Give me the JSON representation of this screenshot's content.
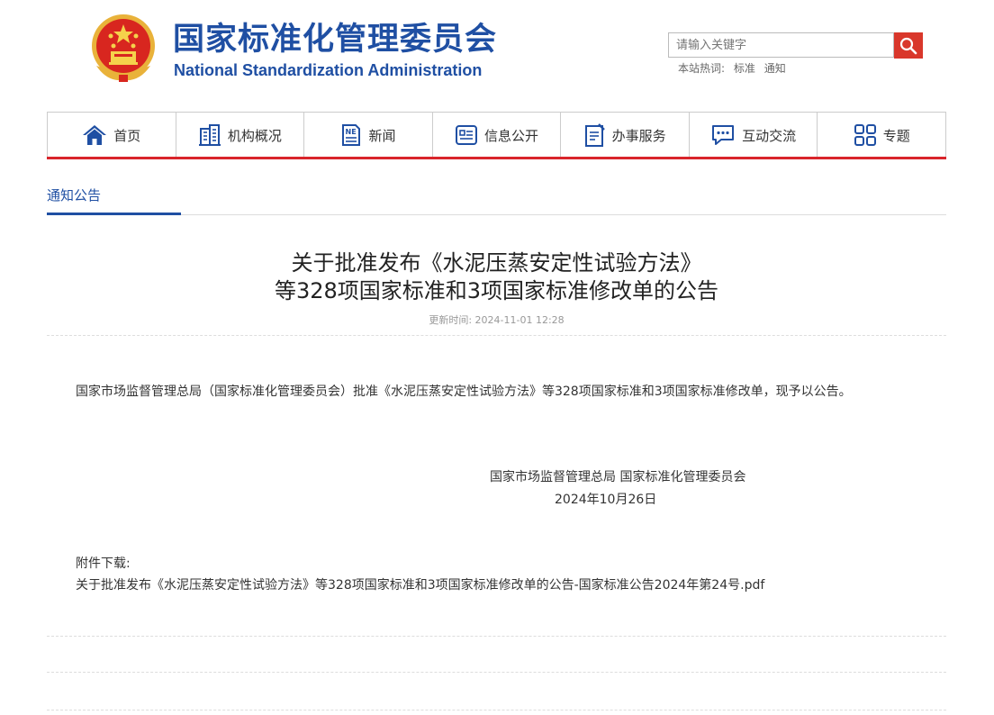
{
  "header": {
    "org_name_cn": "国家标准化管理委员会",
    "org_name_en": "National Standardization Administration",
    "search": {
      "placeholder": "请输入关键字"
    },
    "hot_label": "本站热词:",
    "hot_words": [
      "标准",
      "通知"
    ]
  },
  "nav": {
    "items": [
      {
        "label": "首页",
        "icon": "home-icon"
      },
      {
        "label": "机构概况",
        "icon": "building-icon"
      },
      {
        "label": "新闻",
        "icon": "news-icon"
      },
      {
        "label": "信息公开",
        "icon": "info-icon"
      },
      {
        "label": "办事服务",
        "icon": "service-icon"
      },
      {
        "label": "互动交流",
        "icon": "chat-icon"
      },
      {
        "label": "专题",
        "icon": "grid-icon"
      }
    ]
  },
  "section": {
    "tab": "通知公告"
  },
  "article": {
    "title_line1": "关于批准发布《水泥压蒸安定性试验方法》",
    "title_line2": "等328项国家标准和3项国家标准修改单的公告",
    "updated": "更新时间: 2024-11-01 12:28",
    "body": "国家市场监督管理总局（国家标准化管理委员会）批准《水泥压蒸安定性试验方法》等328项国家标准和3项国家标准修改单，现予以公告。",
    "signature": "国家市场监督管理总局 国家标准化管理委员会",
    "date": "2024年10月26日",
    "attachment_label": "附件下载:",
    "attachment_file": "关于批准发布《水泥压蒸安定性试验方法》等328项国家标准和3项国家标准修改单的公告-国家标准公告2024年第24号.pdf"
  },
  "colors": {
    "brand_blue": "#1f4fa3",
    "accent_red": "#d9252b"
  }
}
